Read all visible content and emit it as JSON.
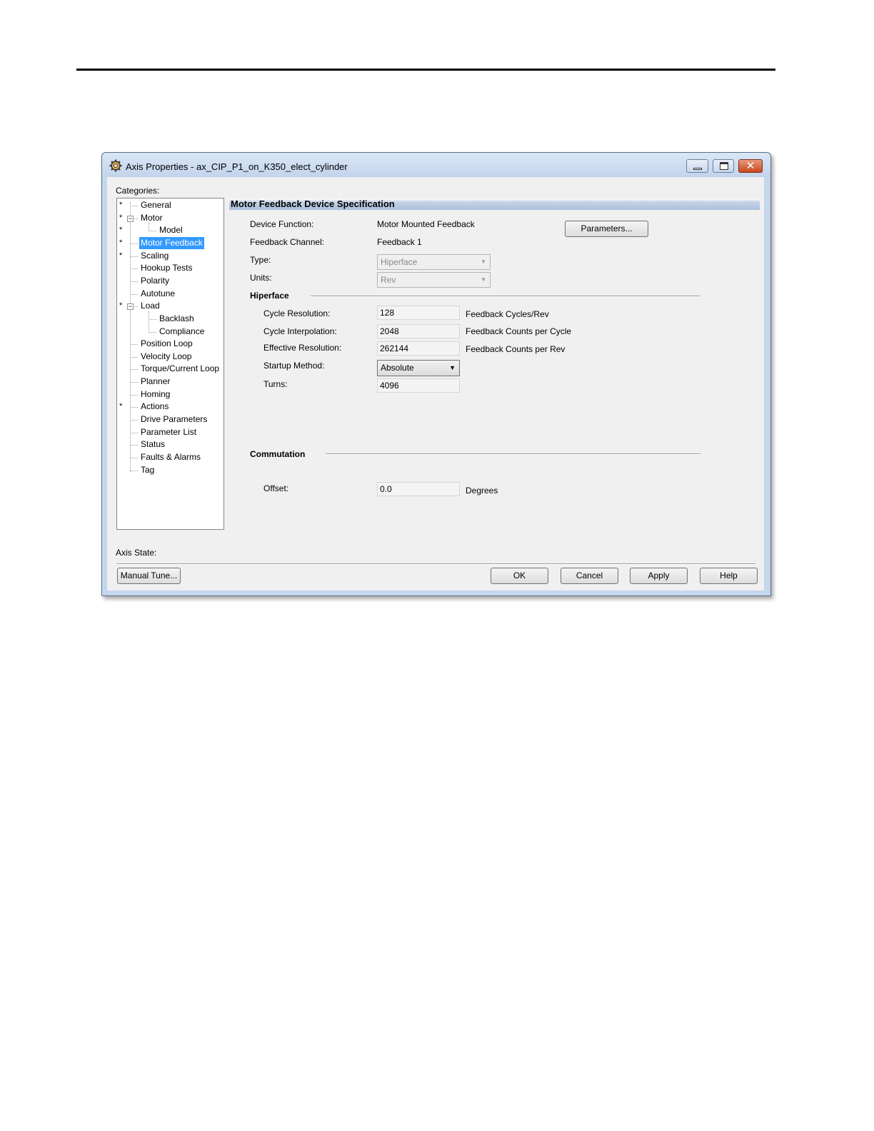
{
  "window": {
    "title": "Axis Properties - ax_CIP_P1_on_K350_elect_cylinder"
  },
  "categories": {
    "label": "Categories:",
    "items": [
      {
        "label": "General",
        "star": true
      },
      {
        "label": "Motor",
        "star": true,
        "expanded": true
      },
      {
        "label": "Model",
        "star": true
      },
      {
        "label": "Motor Feedback",
        "star": true,
        "selected": true
      },
      {
        "label": "Scaling",
        "star": true
      },
      {
        "label": "Hookup Tests"
      },
      {
        "label": "Polarity"
      },
      {
        "label": "Autotune"
      },
      {
        "label": "Load",
        "star": true,
        "expanded": true
      },
      {
        "label": "Backlash"
      },
      {
        "label": "Compliance"
      },
      {
        "label": "Position Loop"
      },
      {
        "label": "Velocity Loop"
      },
      {
        "label": "Torque/Current Loop"
      },
      {
        "label": "Planner"
      },
      {
        "label": "Homing"
      },
      {
        "label": "Actions",
        "star": true
      },
      {
        "label": "Drive Parameters"
      },
      {
        "label": "Parameter List"
      },
      {
        "label": "Status"
      },
      {
        "label": "Faults & Alarms"
      },
      {
        "label": "Tag"
      }
    ],
    "star_symbol": "*"
  },
  "panel": {
    "header": "Motor Feedback Device Specification",
    "device_function_label": "Device Function:",
    "device_function_value": "Motor Mounted Feedback",
    "feedback_channel_label": "Feedback Channel:",
    "feedback_channel_value": "Feedback 1",
    "parameters_button": "Parameters...",
    "type_label": "Type:",
    "type_value": "Hiperface",
    "units_label": "Units:",
    "units_value": "Rev",
    "hiperface_group": "Hiperface",
    "cycle_resolution_label": "Cycle Resolution:",
    "cycle_resolution_value": "128",
    "cycle_resolution_unit": "Feedback Cycles/Rev",
    "cycle_interpolation_label": "Cycle Interpolation:",
    "cycle_interpolation_value": "2048",
    "cycle_interpolation_unit": "Feedback Counts per Cycle",
    "effective_resolution_label": "Effective Resolution:",
    "effective_resolution_value": "262144",
    "effective_resolution_unit": "Feedback Counts per Rev",
    "startup_method_label": "Startup Method:",
    "startup_method_value": "Absolute",
    "turns_label": "Turns:",
    "turns_value": "4096",
    "commutation_group": "Commutation",
    "offset_label": "Offset:",
    "offset_value": "0.0",
    "offset_unit": "Degrees"
  },
  "footer": {
    "axis_state_label": "Axis State:",
    "manual_tune": "Manual Tune...",
    "ok": "OK",
    "cancel": "Cancel",
    "apply": "Apply",
    "help": "Help"
  },
  "icons": {
    "app": "gear-icon",
    "minimize": "minimize-icon",
    "maximize": "maximize-icon",
    "close": "close-icon",
    "close_glyph": "✕",
    "dropdown_arrow": "▼"
  },
  "colors": {
    "selection": "#3399ff",
    "close_button": "#c9461c"
  }
}
